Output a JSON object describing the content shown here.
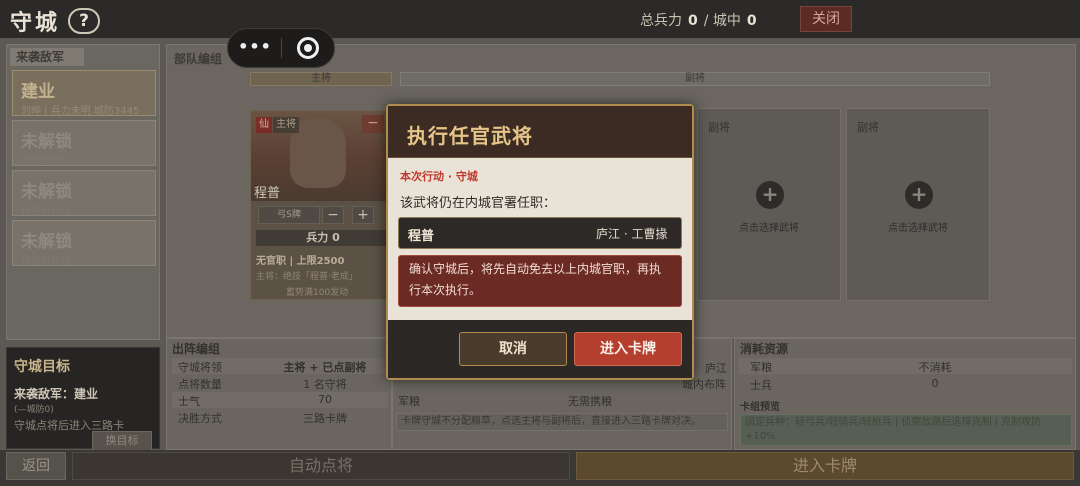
{
  "header": {
    "title": "守城",
    "help_icon": "?",
    "total_troops_label": "总兵力",
    "total_troops_value": "0",
    "separator": "/",
    "in_city_label": "城中",
    "in_city_value": "0",
    "close_label": "关闭"
  },
  "capsule": {
    "more_icon": "•••",
    "close_icon": "target-icon"
  },
  "enemy_panel": {
    "heading": "来袭敌军",
    "items": [
      {
        "name": "建业",
        "sub": "刘晔 | 兵力未明 城防3445"
      },
      {
        "name": "未解锁",
        "sub": "锁定目标位"
      },
      {
        "name": "未解锁",
        "sub": "锁定目标位"
      },
      {
        "name": "未解锁",
        "sub": "锁定目标位"
      }
    ]
  },
  "target": {
    "title": "守城目标",
    "line1": "来袭敌军：建业",
    "line2": "(—城防0)",
    "line3": "守城点将后进入三路卡",
    "change_label": "换目标"
  },
  "formation": {
    "title": "部队编组",
    "main_label": "主将",
    "deputy_label": "副将",
    "general": {
      "badge_xian": "仙",
      "badge_main": "主将",
      "name": "程普",
      "troop_type": "弓S牌",
      "minus": "−",
      "plus": "+",
      "force": "兵力 0",
      "office": "无官职 | 上限2500",
      "skill": "主将：绝技「程普·老成」",
      "skill2": "蓄势满100发动"
    },
    "slots": [
      {
        "label": "副将",
        "caption": "点击选择武将"
      },
      {
        "label": "副将",
        "caption": "点击选择武将"
      }
    ]
  },
  "deploy": {
    "title": "出阵编组",
    "rows": [
      {
        "key": "守城将领",
        "value": "主将 + 已点副将"
      },
      {
        "key": "点将数量",
        "value": "1 名守将"
      },
      {
        "key": "士气",
        "value": "70"
      },
      {
        "key": "决胜方式",
        "value": "三路卡牌"
      }
    ]
  },
  "mid": {
    "lujiang": "庐江",
    "inner": "城内布阵",
    "junliang": "军粮",
    "no_cost": "无需携粮",
    "note": "卡牌守城不分配粮草，点选主将与副将后，直接进入三路卡牌对决。"
  },
  "consume": {
    "title": "消耗资源",
    "rows": [
      {
        "key": "军粮",
        "value": "不消耗"
      },
      {
        "key": "士兵",
        "value": "0"
      }
    ],
    "deck_title": "卡组预览",
    "deck_text": "固定兵种：轻弓兵/轻骑兵/轻枪兵 | 侦察敌路后选择克制 | 克制攻防+10%"
  },
  "bottom": {
    "back": "返回",
    "auto": "自动点将",
    "enter": "进入卡牌"
  },
  "modal": {
    "title": "执行任官武将",
    "sub": "本次行动 · 守城",
    "desc": "该武将仍在内城官署任职：",
    "gen_name": "程普",
    "gen_office": "庐江 · 工曹掾",
    "warning": "确认守城后，将先自动免去以上内城官职，再执行本次执行。",
    "cancel": "取消",
    "confirm": "进入卡牌"
  },
  "colors": {
    "accent_gold": "#b08d4c",
    "confirm_red": "#b43f2f",
    "warning_red": "#6b2a24"
  }
}
